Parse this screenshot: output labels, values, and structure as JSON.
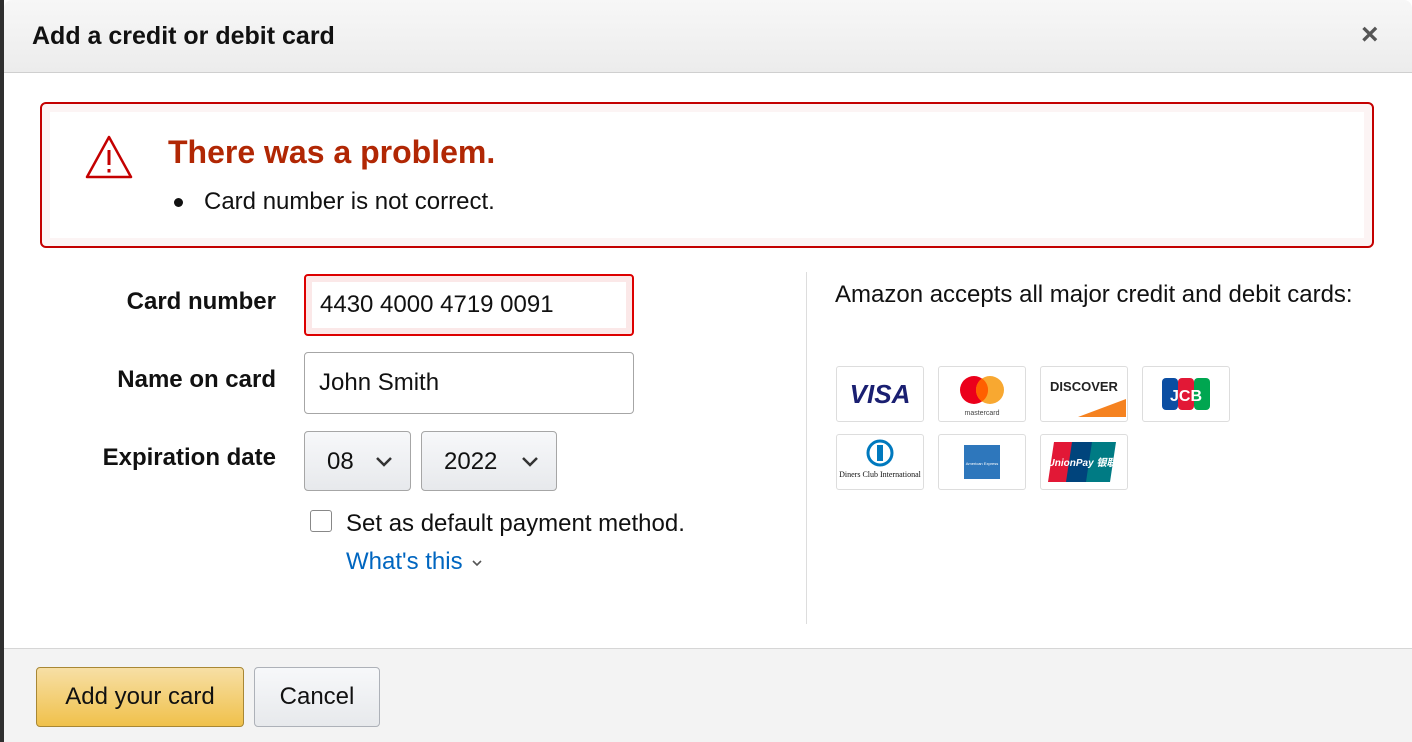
{
  "dialog": {
    "title": "Add a credit or debit card",
    "close_label": "×"
  },
  "alert": {
    "heading": "There was a problem.",
    "messages": [
      "Card number is not correct."
    ],
    "color": "#b12704"
  },
  "form": {
    "card_number_label": "Card number",
    "card_number_value": "4430 4000 4719 0091",
    "name_label": "Name on card",
    "name_value": "John Smith",
    "expiration_label": "Expiration date",
    "exp_month": "08",
    "exp_year": "2022",
    "default_label": "Set as default payment method.",
    "default_checked": false,
    "whats_this": "What's this"
  },
  "accepted": {
    "text": "Amazon accepts all major credit and debit cards:",
    "cards": [
      "VISA",
      "mastercard",
      "DISCOVER",
      "JCB",
      "Diners Club International",
      "American Express",
      "UnionPay 银联"
    ]
  },
  "footer": {
    "add_label": "Add your card",
    "cancel_label": "Cancel"
  },
  "colors": {
    "link": "#0066c0",
    "primary_button": "#f0c14b",
    "error_border": "#c40000"
  }
}
